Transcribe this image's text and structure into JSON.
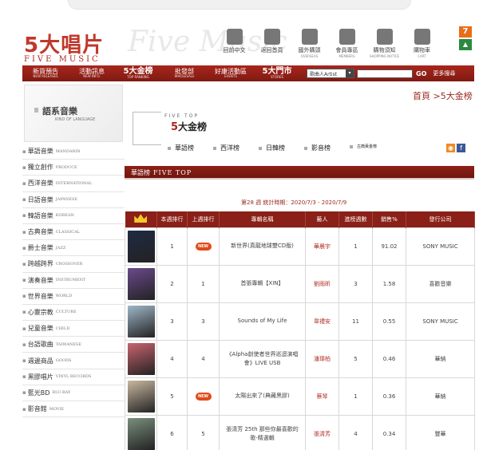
{
  "site": {
    "logo_main": "5大唱片",
    "logo_sub": "FIVE MUSIC",
    "logo_ghost": "Five Music"
  },
  "top_icons": [
    {
      "label": "回前中文",
      "sub": "",
      "icon": "globe-icon"
    },
    {
      "label": "返回首頁",
      "sub": "",
      "icon": "back-arrow-icon"
    },
    {
      "label": "國外購頭",
      "sub": "OVERSEAS",
      "icon": "airplane-icon"
    },
    {
      "label": "會員專區",
      "sub": "MEMBERS",
      "icon": "members-icon"
    },
    {
      "label": "購物須知",
      "sub": "SHOPPING NOTICE",
      "icon": "cup-icon"
    },
    {
      "label": "購物車",
      "sub": "CART",
      "icon": "cart-icon"
    }
  ],
  "nav": {
    "items": [
      {
        "zh": "新貨預告",
        "en": "NEW RELEASES",
        "big": false
      },
      {
        "zh": "活動訊息",
        "en": "NEW INFO.",
        "big": false
      },
      {
        "zh": "5大金榜",
        "en": "TOP RANKING",
        "big": true
      },
      {
        "zh": "批發部",
        "en": "WHOLESALE",
        "big": false
      },
      {
        "zh": "好康活動區",
        "en": "EVENTS",
        "big": false
      },
      {
        "zh": "5大門市",
        "en": "STORES",
        "big": true
      }
    ],
    "select_value": "歌曲人Artist",
    "go_label": "GO",
    "more_label": "更多搜尋"
  },
  "sidebar": {
    "banner_title": "語系音樂",
    "banner_sub": "KIND OF LANGUAGE",
    "items": [
      {
        "zh": "華語音樂",
        "en": "MANDARIN"
      },
      {
        "zh": "獨立創作",
        "en": "PRODUCE"
      },
      {
        "zh": "西洋音樂",
        "en": "INTERNATIONAL"
      },
      {
        "zh": "日語音樂",
        "en": "JAPANESE"
      },
      {
        "zh": "韓語音樂",
        "en": "KOREAN"
      },
      {
        "zh": "古典音樂",
        "en": "CLASSICAL"
      },
      {
        "zh": "爵士音樂",
        "en": "JAZZ"
      },
      {
        "zh": "跨越跨界",
        "en": "CROSSOVER"
      },
      {
        "zh": "演奏音樂",
        "en": "INSTRUMENT"
      },
      {
        "zh": "世界音樂",
        "en": "WORLD"
      },
      {
        "zh": "心靈宗教",
        "en": "CULTURE"
      },
      {
        "zh": "兒童音樂",
        "en": "CHILD"
      },
      {
        "zh": "台語歌曲",
        "en": "TAIWANESE"
      },
      {
        "zh": "週邊商品",
        "en": "GOODS"
      },
      {
        "zh": "黑膠唱片",
        "en": "VINYL RECORDS"
      },
      {
        "zh": "藍光BD",
        "en": "BLU-RAY"
      },
      {
        "zh": "影音館",
        "en": "MOVIE"
      }
    ]
  },
  "breadcrumb": "首頁 >5大金榜",
  "page_title": {
    "five_top": "FIVE TOP",
    "name_red": "5",
    "name": "大金榜"
  },
  "subtabs": [
    "華語榜",
    "西洋榜",
    "日韓榜",
    "影音榜",
    "古典黃金榜"
  ],
  "section_bar": {
    "zh": "華語榜",
    "en": "FIVE TOP"
  },
  "week_line": "第28 週 統計時期：2020/7/3 - 2020/7/9",
  "table": {
    "headers": [
      "本週排行",
      "上週排行",
      "專輯名稱",
      "藝人",
      "進榜週數",
      "銷售%",
      "發行公司"
    ],
    "rows": [
      {
        "rank": "1",
        "last": "NEW",
        "album": "新世界(真龍地球雙CD版)",
        "artist": "華晨宇",
        "weeks": "1",
        "sales": "91.02",
        "label": "SONY MUSIC",
        "cover": "#1f2a44"
      },
      {
        "rank": "2",
        "last": "1",
        "album": "首張專輯【XIN】",
        "artist": "劉雨昕",
        "weeks": "3",
        "sales": "1.58",
        "label": "喜歡音樂",
        "cover": "#6b4a8c"
      },
      {
        "rank": "3",
        "last": "3",
        "album": "Sounds of My Life",
        "artist": "韋禮安",
        "weeks": "11",
        "sales": "0.55",
        "label": "SONY MUSIC",
        "cover": "#9fb7c9"
      },
      {
        "rank": "4",
        "last": "4",
        "album": "《Alpha創使者世界巡迴演唱會》LIVE USB",
        "artist": "潘瑋柏",
        "weeks": "5",
        "sales": "0.46",
        "label": "華納",
        "cover": "#c9646f"
      },
      {
        "rank": "5",
        "last": "NEW",
        "album": "太陽出來了(典藏黑膠)",
        "artist": "蔡琴",
        "weeks": "1",
        "sales": "0.36",
        "label": "華納",
        "cover": "#c9b8a0"
      },
      {
        "rank": "6",
        "last": "5",
        "album": "張清芳 25th 那些你最喜歡的歌-精選輯",
        "artist": "張清芳",
        "weeks": "4",
        "sales": "0.34",
        "label": "豐華",
        "cover": "#7a8f7d"
      }
    ]
  }
}
